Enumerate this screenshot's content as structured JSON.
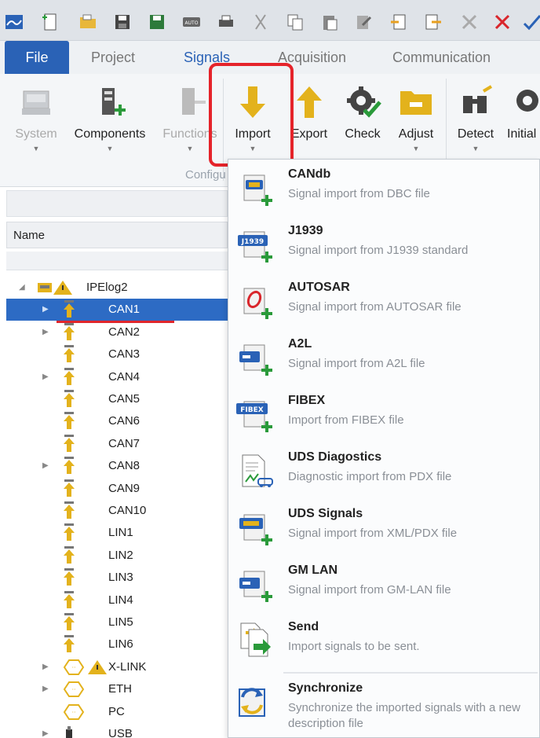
{
  "tabs": {
    "file": "File",
    "project": "Project",
    "signals": "Signals",
    "acquisition": "Acquisition",
    "communication": "Communication"
  },
  "ribbon": {
    "system": "System",
    "components": "Components",
    "functions": "Functions",
    "import": "Import",
    "export": "Export",
    "check": "Check",
    "adjust": "Adjust",
    "detect": "Detect",
    "initial": "Initial",
    "group_label": "Configu"
  },
  "tree": {
    "header": "Name",
    "root": "IPElog2",
    "items": [
      "CAN1",
      "CAN2",
      "CAN3",
      "CAN4",
      "CAN5",
      "CAN6",
      "CAN7",
      "CAN8",
      "CAN9",
      "CAN10",
      "LIN1",
      "LIN2",
      "LIN3",
      "LIN4",
      "LIN5",
      "LIN6",
      "X-LINK",
      "ETH",
      "PC",
      "USB"
    ]
  },
  "menu": [
    {
      "title": "CANdb",
      "desc": "Signal import from DBC file",
      "icon": "candb-icon"
    },
    {
      "title": "J1939",
      "desc": "Signal import from J1939 standard",
      "icon": "j1939-icon"
    },
    {
      "title": "AUTOSAR",
      "desc": "Signal import from AUTOSAR file",
      "icon": "autosar-icon"
    },
    {
      "title": "A2L",
      "desc": "Signal import from A2L file",
      "icon": "a2l-icon"
    },
    {
      "title": "FIBEX",
      "desc": "Import from FIBEX file",
      "icon": "fibex-icon"
    },
    {
      "title": "UDS Diagostics",
      "desc": "Diagnostic import from PDX file",
      "icon": "uds-diagnostics-icon"
    },
    {
      "title": "UDS Signals",
      "desc": "Signal import from XML/PDX file",
      "icon": "uds-signals-icon"
    },
    {
      "title": "GM LAN",
      "desc": "Signal import from GM-LAN file",
      "icon": "gmlan-icon"
    },
    {
      "title": "Send",
      "desc": "Import signals to be sent.",
      "icon": "send-icon"
    },
    {
      "title": "Synchronize",
      "desc": "Synchronize the imported signals with a new description file",
      "icon": "synchronize-icon"
    }
  ],
  "badges": {
    "j1939": "J1939",
    "fibex": "FIBEX"
  },
  "colors": {
    "accent": "#2a62b6",
    "highlight": "#e5232a",
    "selection": "#2d6bc4"
  }
}
